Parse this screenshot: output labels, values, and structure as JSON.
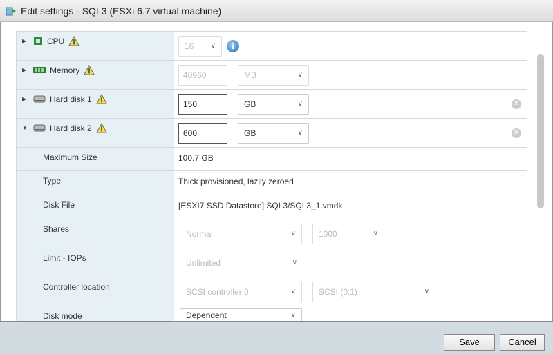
{
  "title": "Edit settings - SQL3 (ESXi 6.7 virtual machine)",
  "rows": {
    "cpu": {
      "label": "CPU",
      "value": "16"
    },
    "memory": {
      "label": "Memory",
      "value": "40960",
      "unit": "MB"
    },
    "hd1": {
      "label": "Hard disk 1",
      "value": "150",
      "unit": "GB"
    },
    "hd2": {
      "label": "Hard disk 2",
      "value": "600",
      "unit": "GB"
    }
  },
  "hd2_details": {
    "max_size": {
      "label": "Maximum Size",
      "value": "100.7 GB"
    },
    "type": {
      "label": "Type",
      "value": "Thick provisioned, lazily zeroed"
    },
    "disk_file": {
      "label": "Disk File",
      "value": "[ESXI7 SSD Datastore] SQL3/SQL3_1.vmdk"
    },
    "shares": {
      "label": "Shares",
      "level": "Normal",
      "value": "1000"
    },
    "limit": {
      "label": "Limit - IOPs",
      "value": "Unlimited"
    },
    "controller": {
      "label": "Controller location",
      "controller": "SCSI controller 0",
      "node": "SCSI (0:1)"
    },
    "disk_mode": {
      "label": "Disk mode",
      "value": "Dependent"
    }
  },
  "buttons": {
    "save": "Save",
    "cancel": "Cancel"
  }
}
